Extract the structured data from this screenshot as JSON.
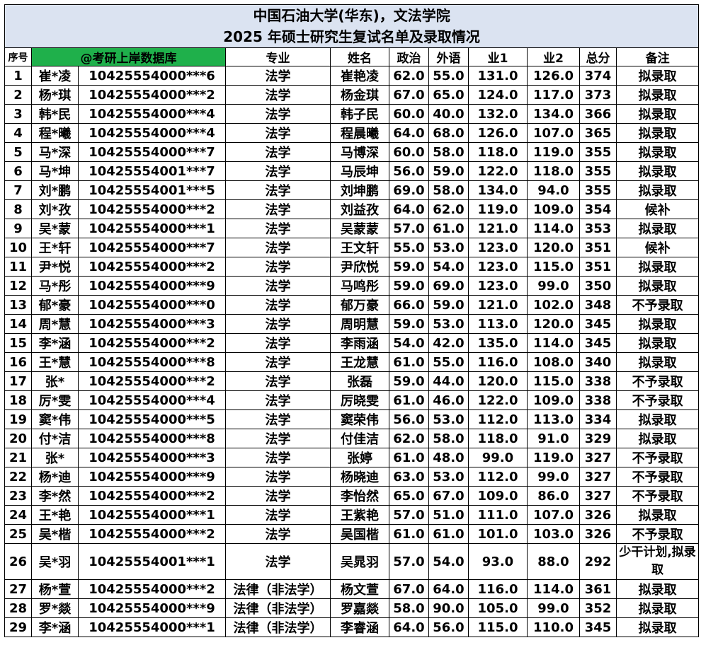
{
  "title_line1": "中国石油大学(华东)，文法学院",
  "title_line2": "2025 年硕士研究生复试名单及录取情况",
  "headers": {
    "seq": "序号",
    "name_masked": "@考研上岸数据库",
    "major": "专业",
    "name": "姓名",
    "politics": "政治",
    "foreign_lang": "外语",
    "subject1": "业1",
    "subject2": "业2",
    "total": "总分",
    "note": "备注"
  },
  "rows": [
    {
      "seq": "1",
      "masked": "崔*凌",
      "id": "10425554000***6",
      "major": "法学",
      "name": "崔艳凌",
      "politics": "62.0",
      "foreign": "55.0",
      "s1": "131.0",
      "s2": "126.0",
      "total": "374",
      "note": "拟录取"
    },
    {
      "seq": "2",
      "masked": "杨*琪",
      "id": "10425554000***2",
      "major": "法学",
      "name": "杨金琪",
      "politics": "67.0",
      "foreign": "65.0",
      "s1": "124.0",
      "s2": "117.0",
      "total": "373",
      "note": "拟录取"
    },
    {
      "seq": "3",
      "masked": "韩*民",
      "id": "10425554000***4",
      "major": "法学",
      "name": "韩子民",
      "politics": "60.0",
      "foreign": "40.0",
      "s1": "132.0",
      "s2": "134.0",
      "total": "366",
      "note": "拟录取"
    },
    {
      "seq": "4",
      "masked": "程*曦",
      "id": "10425554000***4",
      "major": "法学",
      "name": "程晨曦",
      "politics": "64.0",
      "foreign": "68.0",
      "s1": "126.0",
      "s2": "107.0",
      "total": "365",
      "note": "拟录取"
    },
    {
      "seq": "5",
      "masked": "马*深",
      "id": "10425554000***7",
      "major": "法学",
      "name": "马博深",
      "politics": "60.0",
      "foreign": "58.0",
      "s1": "118.0",
      "s2": "119.0",
      "total": "355",
      "note": "拟录取"
    },
    {
      "seq": "6",
      "masked": "马*坤",
      "id": "10425554001***7",
      "major": "法学",
      "name": "马辰坤",
      "politics": "56.0",
      "foreign": "59.0",
      "s1": "122.0",
      "s2": "118.0",
      "total": "355",
      "note": "拟录取"
    },
    {
      "seq": "7",
      "masked": "刘*鹏",
      "id": "10425554001***5",
      "major": "法学",
      "name": "刘坤鹏",
      "politics": "69.0",
      "foreign": "58.0",
      "s1": "134.0",
      "s2": "94.0",
      "total": "355",
      "note": "拟录取"
    },
    {
      "seq": "8",
      "masked": "刘*孜",
      "id": "10425554000***2",
      "major": "法学",
      "name": "刘益孜",
      "politics": "64.0",
      "foreign": "62.0",
      "s1": "119.0",
      "s2": "109.0",
      "total": "354",
      "note": "候补"
    },
    {
      "seq": "9",
      "masked": "吴*蒙",
      "id": "10425554000***1",
      "major": "法学",
      "name": "吴蒙蒙",
      "politics": "57.0",
      "foreign": "61.0",
      "s1": "121.0",
      "s2": "114.0",
      "total": "353",
      "note": "拟录取"
    },
    {
      "seq": "10",
      "masked": "王*轩",
      "id": "10425554000***7",
      "major": "法学",
      "name": "王文轩",
      "politics": "55.0",
      "foreign": "53.0",
      "s1": "123.0",
      "s2": "120.0",
      "total": "351",
      "note": "候补"
    },
    {
      "seq": "11",
      "masked": "尹*悦",
      "id": "10425554000***2",
      "major": "法学",
      "name": "尹欣悦",
      "politics": "59.0",
      "foreign": "54.0",
      "s1": "123.0",
      "s2": "115.0",
      "total": "351",
      "note": "拟录取"
    },
    {
      "seq": "12",
      "masked": "马*彤",
      "id": "10425554000***9",
      "major": "法学",
      "name": "马鸣彤",
      "politics": "59.0",
      "foreign": "69.0",
      "s1": "123.0",
      "s2": "99.0",
      "total": "350",
      "note": "拟录取"
    },
    {
      "seq": "13",
      "masked": "郁*豪",
      "id": "10425554000***0",
      "major": "法学",
      "name": "郁万豪",
      "politics": "66.0",
      "foreign": "59.0",
      "s1": "121.0",
      "s2": "102.0",
      "total": "348",
      "note": "不予录取"
    },
    {
      "seq": "14",
      "masked": "周*慧",
      "id": "10425554000***3",
      "major": "法学",
      "name": "周明慧",
      "politics": "59.0",
      "foreign": "53.0",
      "s1": "113.0",
      "s2": "120.0",
      "total": "345",
      "note": "拟录取"
    },
    {
      "seq": "15",
      "masked": "李*涵",
      "id": "10425554000***2",
      "major": "法学",
      "name": "李雨涵",
      "politics": "54.0",
      "foreign": "42.0",
      "s1": "135.0",
      "s2": "114.0",
      "total": "345",
      "note": "拟录取"
    },
    {
      "seq": "16",
      "masked": "王*慧",
      "id": "10425554000***8",
      "major": "法学",
      "name": "王龙慧",
      "politics": "61.0",
      "foreign": "55.0",
      "s1": "116.0",
      "s2": "108.0",
      "total": "340",
      "note": "拟录取"
    },
    {
      "seq": "17",
      "masked": "张*",
      "id": "10425554000***2",
      "major": "法学",
      "name": "张磊",
      "politics": "59.0",
      "foreign": "44.0",
      "s1": "120.0",
      "s2": "115.0",
      "total": "338",
      "note": "不予录取"
    },
    {
      "seq": "18",
      "masked": "厉*雯",
      "id": "10425554000***4",
      "major": "法学",
      "name": "厉晓雯",
      "politics": "61.0",
      "foreign": "46.0",
      "s1": "122.0",
      "s2": "109.0",
      "total": "338",
      "note": "不予录取"
    },
    {
      "seq": "19",
      "masked": "窦*伟",
      "id": "10425554000***5",
      "major": "法学",
      "name": "窦荣伟",
      "politics": "56.0",
      "foreign": "53.0",
      "s1": "112.0",
      "s2": "113.0",
      "total": "334",
      "note": "拟录取"
    },
    {
      "seq": "20",
      "masked": "付*洁",
      "id": "10425554000***8",
      "major": "法学",
      "name": "付佳洁",
      "politics": "62.0",
      "foreign": "58.0",
      "s1": "118.0",
      "s2": "91.0",
      "total": "329",
      "note": "拟录取"
    },
    {
      "seq": "21",
      "masked": "张*",
      "id": "10425554000***3",
      "major": "法学",
      "name": "张婷",
      "politics": "61.0",
      "foreign": "48.0",
      "s1": "99.0",
      "s2": "119.0",
      "total": "327",
      "note": "不予录取"
    },
    {
      "seq": "22",
      "masked": "杨*迪",
      "id": "10425554000***9",
      "major": "法学",
      "name": "杨晓迪",
      "politics": "63.0",
      "foreign": "53.0",
      "s1": "112.0",
      "s2": "99.0",
      "total": "327",
      "note": "不予录取"
    },
    {
      "seq": "23",
      "masked": "李*然",
      "id": "10425554000***2",
      "major": "法学",
      "name": "李怡然",
      "politics": "65.0",
      "foreign": "67.0",
      "s1": "109.0",
      "s2": "86.0",
      "total": "327",
      "note": "不予录取"
    },
    {
      "seq": "24",
      "masked": "王*艳",
      "id": "10425554000***1",
      "major": "法学",
      "name": "王紫艳",
      "politics": "57.0",
      "foreign": "51.0",
      "s1": "111.0",
      "s2": "107.0",
      "total": "326",
      "note": "拟录取"
    },
    {
      "seq": "25",
      "masked": "吴*楷",
      "id": "10425554000***2",
      "major": "法学",
      "name": "吴国楷",
      "politics": "61.0",
      "foreign": "61.0",
      "s1": "101.0",
      "s2": "103.0",
      "total": "326",
      "note": "不予录取"
    },
    {
      "seq": "26",
      "masked": "吴*羽",
      "id": "10425554001***1",
      "major": "法学",
      "name": "吴晁羽",
      "politics": "57.0",
      "foreign": "54.0",
      "s1": "93.0",
      "s2": "88.0",
      "total": "292",
      "note": "少干计划,拟录取"
    },
    {
      "seq": "27",
      "masked": "杨*萱",
      "id": "10425554000***2",
      "major": "法律（非法学）",
      "name": "杨文萱",
      "politics": "67.0",
      "foreign": "64.0",
      "s1": "116.0",
      "s2": "114.0",
      "total": "361",
      "note": "拟录取"
    },
    {
      "seq": "28",
      "masked": "罗*燚",
      "id": "10425554000***9",
      "major": "法律（非法学）",
      "name": "罗嘉燚",
      "politics": "58.0",
      "foreign": "90.0",
      "s1": "105.0",
      "s2": "99.0",
      "total": "352",
      "note": "拟录取"
    },
    {
      "seq": "29",
      "masked": "李*涵",
      "id": "10425554000***1",
      "major": "法律（非法学）",
      "name": "李睿涵",
      "politics": "64.0",
      "foreign": "56.0",
      "s1": "115.0",
      "s2": "110.0",
      "total": "345",
      "note": "拟录取"
    }
  ],
  "colors": {
    "title_bg": "#dbe3f1",
    "header_highlight_bg": "#1fb04b",
    "grid_line": "#000000"
  }
}
